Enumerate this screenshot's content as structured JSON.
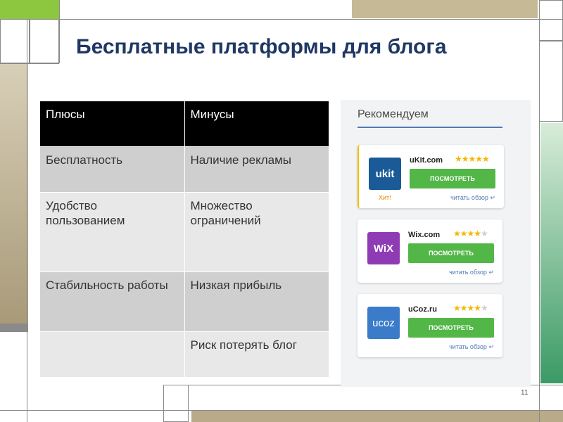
{
  "slide": {
    "title": "Бесплатные платформы для блога",
    "page_number": "11"
  },
  "table": {
    "headers": [
      "Плюсы",
      "Минусы"
    ],
    "rows": [
      [
        "Бесплатность",
        "Наличие рекламы"
      ],
      [
        "Удобство пользованием",
        "Множество ограничений"
      ],
      [
        "Стабильность работы",
        "Низкая прибыль"
      ],
      [
        "",
        "Риск потерять блог"
      ]
    ]
  },
  "recommend": {
    "title": "Рекомендуем",
    "cards": [
      {
        "logo_text": "ukit",
        "logo_color": "#1a5a96",
        "site": "uKit.com",
        "rating": 5,
        "button": "ПОСМОТРЕТЬ",
        "review": "читать обзор",
        "badge": "Хит!"
      },
      {
        "logo_text": "WiX",
        "logo_color": "#8e3bb5",
        "site": "Wix.com",
        "rating": 4,
        "button": "ПОСМОТРЕТЬ",
        "review": "читать обзор"
      },
      {
        "logo_text": "ucoz",
        "logo_color": "#3a7cc9",
        "site": "uCoz.ru",
        "rating": 4,
        "button": "ПОСМОТРЕТЬ",
        "review": "читать обзор"
      }
    ]
  },
  "colors": {
    "title": "#1f3864",
    "accent_green": "#52b747",
    "deco_tan": "#b9ab8a",
    "deco_green": "#3b9a66",
    "deco_lime": "#8dc63f"
  }
}
